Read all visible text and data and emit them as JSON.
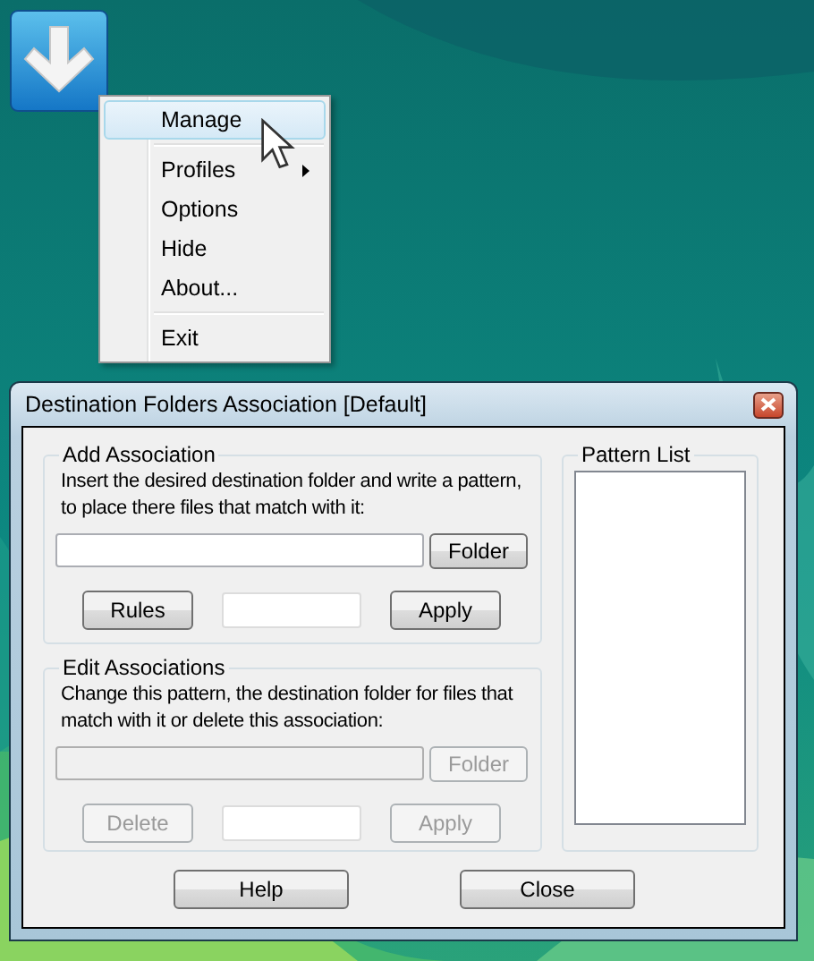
{
  "context_menu": {
    "items": [
      {
        "kind": "item",
        "label": "Manage",
        "selected": true,
        "submenu": false
      },
      {
        "kind": "separator"
      },
      {
        "kind": "item",
        "label": "Profiles",
        "selected": false,
        "submenu": true
      },
      {
        "kind": "item",
        "label": "Options",
        "selected": false,
        "submenu": false
      },
      {
        "kind": "item",
        "label": "Hide",
        "selected": false,
        "submenu": false
      },
      {
        "kind": "item",
        "label": "About...",
        "selected": false,
        "submenu": false
      },
      {
        "kind": "separator"
      },
      {
        "kind": "item",
        "label": "Exit",
        "selected": false,
        "submenu": false
      }
    ]
  },
  "dialog": {
    "title": "Destination Folders Association [Default]",
    "add_association": {
      "title": "Add Association",
      "description": "Insert the desired destination folder and write a pattern, to place there files that match with it:",
      "disabled": false,
      "folder_button": "Folder",
      "left_button": "Rules",
      "left_disabled": false,
      "apply_button": "Apply"
    },
    "edit_associations": {
      "title": "Edit Associations",
      "description": "Change this pattern, the destination folder for files that match with it or delete this association:",
      "disabled": true,
      "folder_button": "Folder",
      "left_button": "Delete",
      "left_disabled": true,
      "apply_button": "Apply"
    },
    "pattern_list": {
      "title": "Pattern List"
    },
    "buttons": [
      "Help",
      "Close"
    ]
  }
}
